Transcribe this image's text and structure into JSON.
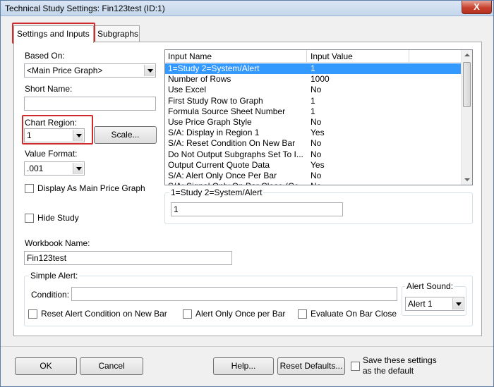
{
  "window": {
    "title": "Technical Study Settings: Fin123test (ID:1)",
    "close_label": "X"
  },
  "tabs": [
    {
      "label": "Settings and Inputs"
    },
    {
      "label": "Subgraphs"
    }
  ],
  "left": {
    "based_on_label": "Based On:",
    "based_on_value": "<Main Price Graph>",
    "short_name_label": "Short Name:",
    "short_name_value": "",
    "chart_region_label": "Chart Region:",
    "chart_region_value": "1",
    "scale_button": "Scale...",
    "value_format_label": "Value Format:",
    "value_format_value": ".001",
    "display_as_main_label": "Display As Main Price Graph",
    "hide_study_label": "Hide Study"
  },
  "inputs_grid": {
    "col_name": "Input Name",
    "col_value": "Input Value",
    "rows": [
      {
        "name": "1=Study 2=System/Alert",
        "value": "1"
      },
      {
        "name": "Number of Rows",
        "value": "1000"
      },
      {
        "name": "Use Excel",
        "value": "No"
      },
      {
        "name": "First Study Row to Graph",
        "value": "1"
      },
      {
        "name": "Formula Source Sheet Number",
        "value": "1"
      },
      {
        "name": "Use Price Graph Style",
        "value": "No"
      },
      {
        "name": "S/A: Display in Region 1",
        "value": "Yes"
      },
      {
        "name": "S/A: Reset Condition On New Bar",
        "value": "No"
      },
      {
        "name": "Do Not Output Subgraphs Set To I...",
        "value": "No"
      },
      {
        "name": "Output Current Quote Data",
        "value": "Yes"
      },
      {
        "name": "S/A: Alert Only Once Per Bar",
        "value": "No"
      },
      {
        "name": "S/A: Signal Only On Bar Close (Co...",
        "value": "No"
      }
    ],
    "selected_row": 0
  },
  "input_edit": {
    "group_label": "1=Study 2=System/Alert",
    "value": "1"
  },
  "workbook": {
    "label": "Workbook Name:",
    "value": "Fin123test"
  },
  "simple_alert": {
    "group_label": "Simple Alert:",
    "condition_label": "Condition:",
    "condition_value": "",
    "alert_sound_label": "Alert Sound:",
    "alert_sound_value": "Alert 1",
    "reset_label": "Reset Alert Condition on New Bar",
    "once_label": "Alert Only Once per Bar",
    "evaluate_label": "Evaluate On Bar Close"
  },
  "footer": {
    "ok": "OK",
    "cancel": "Cancel",
    "help": "Help...",
    "reset_defaults": "Reset Defaults...",
    "save_line1": "Save these settings",
    "save_line2": "as the default"
  },
  "colors": {
    "highlight_box": "#d02a2a",
    "selection": "#3399ff"
  }
}
